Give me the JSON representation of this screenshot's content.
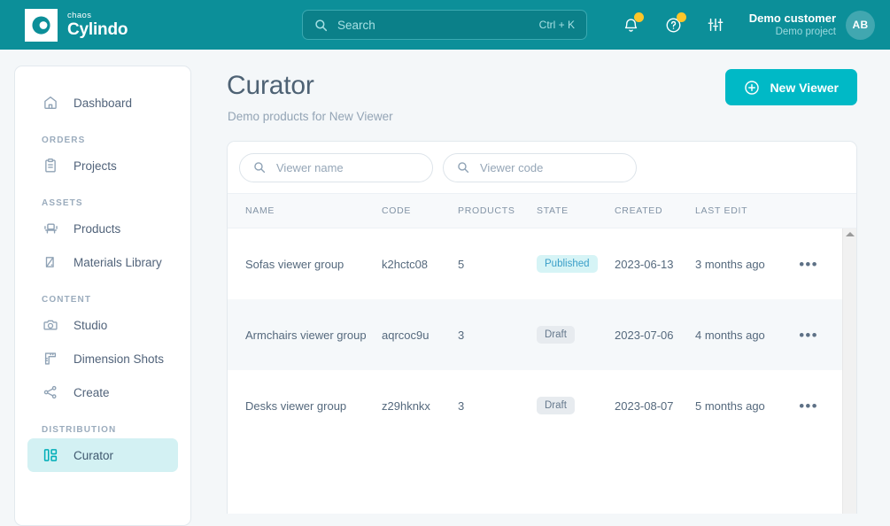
{
  "topbar": {
    "logo": {
      "brand_small": "chaos",
      "brand_main": "Cylindo"
    },
    "search": {
      "placeholder": "Search",
      "shortcut": "Ctrl + K"
    },
    "account": {
      "customer": "Demo customer",
      "project": "Demo project",
      "initials": "AB"
    },
    "colors": {
      "bar_bg": "#0c8f99",
      "search_bg": "#0b8089",
      "badge": "#ffc629"
    }
  },
  "sidebar": {
    "items": [
      {
        "label": "Dashboard",
        "icon": "home-icon",
        "active": false
      },
      {
        "label": "Projects",
        "icon": "clipboard-icon",
        "active": false
      },
      {
        "label": "Products",
        "icon": "chair-icon",
        "active": false
      },
      {
        "label": "Materials Library",
        "icon": "material-swatch-icon",
        "active": false
      },
      {
        "label": "Studio",
        "icon": "camera-icon",
        "active": false
      },
      {
        "label": "Dimension Shots",
        "icon": "ruler-icon",
        "active": false
      },
      {
        "label": "Create",
        "icon": "share-icon",
        "active": false
      },
      {
        "label": "Curator",
        "icon": "layout-grid-icon",
        "active": true
      }
    ],
    "sections": {
      "orders": "ORDERS",
      "assets": "ASSETS",
      "content": "CONTENT",
      "distribution": "DISTRIBUTION"
    },
    "active_bg": "#d3f1f3"
  },
  "main": {
    "title": "Curator",
    "subtitle": "Demo products for New Viewer",
    "new_viewer_button": "New Viewer",
    "new_viewer_color": "#00b9c6",
    "filters": [
      {
        "placeholder": "Viewer name",
        "value": "",
        "name": "viewer-name"
      },
      {
        "placeholder": "Viewer code",
        "value": "",
        "name": "viewer-code"
      }
    ],
    "table": {
      "columns": [
        "NAME",
        "CODE",
        "PRODUCTS",
        "STATE",
        "CREATED",
        "LAST EDIT"
      ],
      "rows": [
        {
          "name": "Sofas viewer group",
          "code": "k2hctc08",
          "products": "5",
          "state": "Published",
          "state_type": "published",
          "created": "2023-06-13",
          "last_edit": "3 months ago",
          "actions": "•••"
        },
        {
          "name": "Armchairs viewer group",
          "code": "aqrcoc9u",
          "products": "3",
          "state": "Draft",
          "state_type": "draft",
          "created": "2023-07-06",
          "last_edit": "4 months ago",
          "actions": "•••"
        },
        {
          "name": "Desks viewer group",
          "code": "z29hknkx",
          "products": "3",
          "state": "Draft",
          "state_type": "draft",
          "created": "2023-08-07",
          "last_edit": "5 months ago",
          "actions": "•••"
        }
      ]
    }
  }
}
